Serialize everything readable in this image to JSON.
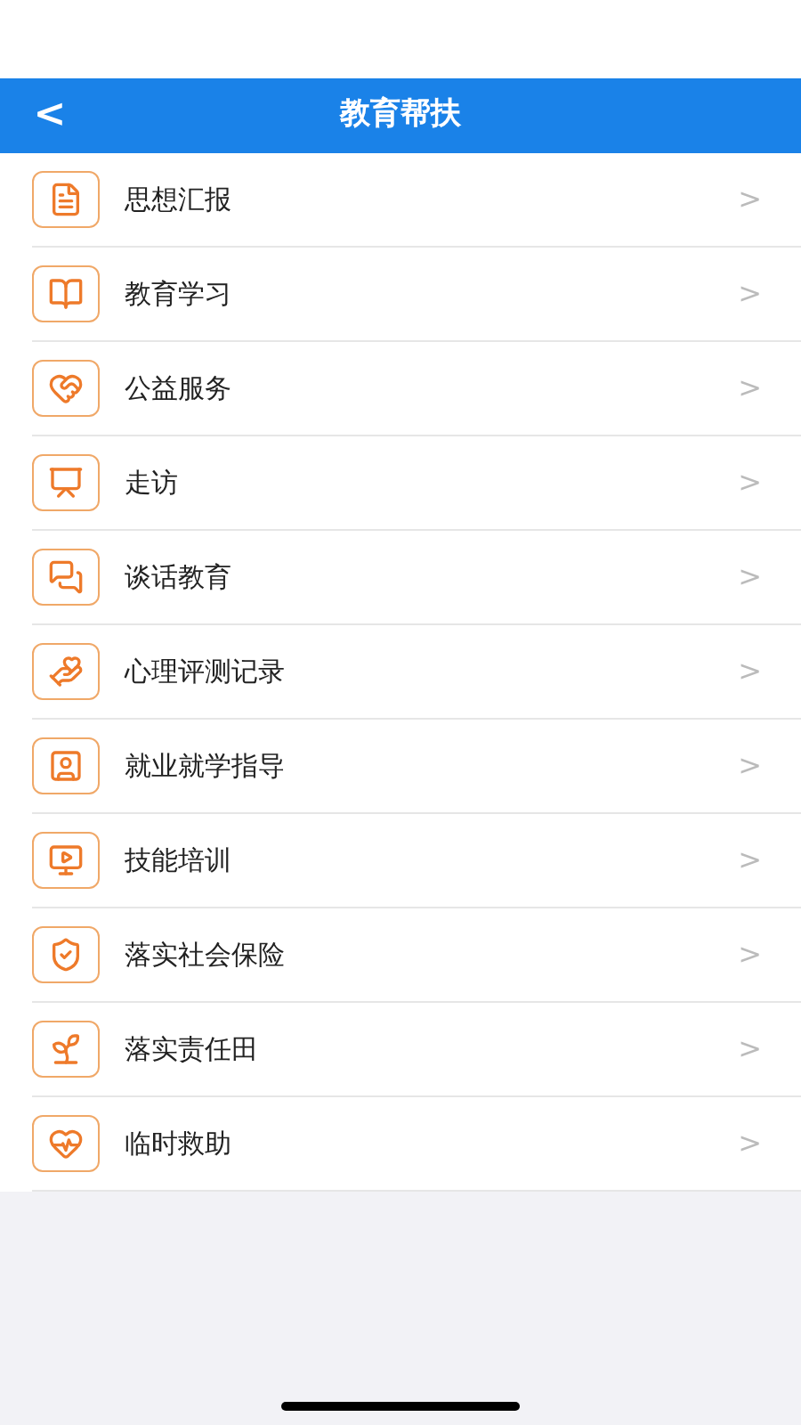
{
  "header": {
    "back": "<",
    "title": "教育帮扶"
  },
  "menu": [
    {
      "label": "思想汇报",
      "chevron": ">"
    },
    {
      "label": "教育学习",
      "chevron": ">"
    },
    {
      "label": "公益服务",
      "chevron": ">"
    },
    {
      "label": "走访",
      "chevron": ">"
    },
    {
      "label": "谈话教育",
      "chevron": ">"
    },
    {
      "label": "心理评测记录",
      "chevron": ">"
    },
    {
      "label": "就业就学指导",
      "chevron": ">"
    },
    {
      "label": "技能培训",
      "chevron": ">"
    },
    {
      "label": "落实社会保险",
      "chevron": ">"
    },
    {
      "label": "落实责任田",
      "chevron": ">"
    },
    {
      "label": "临时救助",
      "chevron": ">"
    }
  ]
}
